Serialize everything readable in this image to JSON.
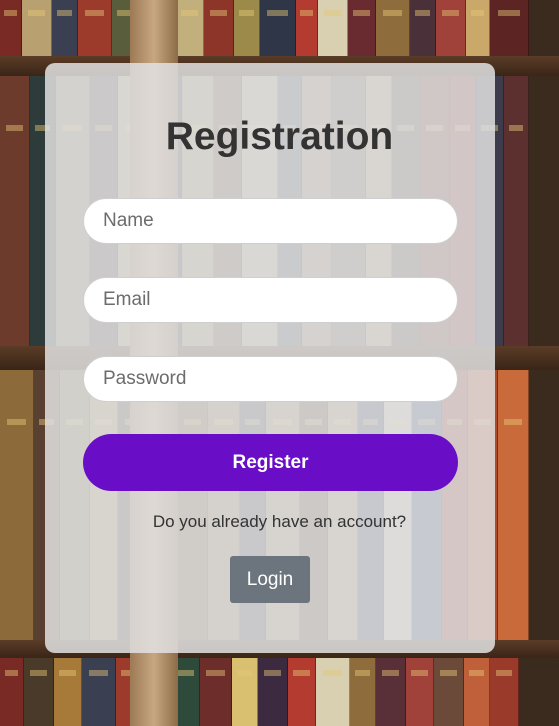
{
  "form": {
    "title": "Registration",
    "name_placeholder": "Name",
    "email_placeholder": "Email",
    "password_placeholder": "Password",
    "register_label": "Register",
    "account_question": "Do you already have an account?",
    "login_label": "Login"
  },
  "colors": {
    "primary_button": "#6a0dc7",
    "secondary_button": "#6c757d",
    "title_text": "#333333",
    "card_background": "rgba(225,225,225,0.86)"
  }
}
